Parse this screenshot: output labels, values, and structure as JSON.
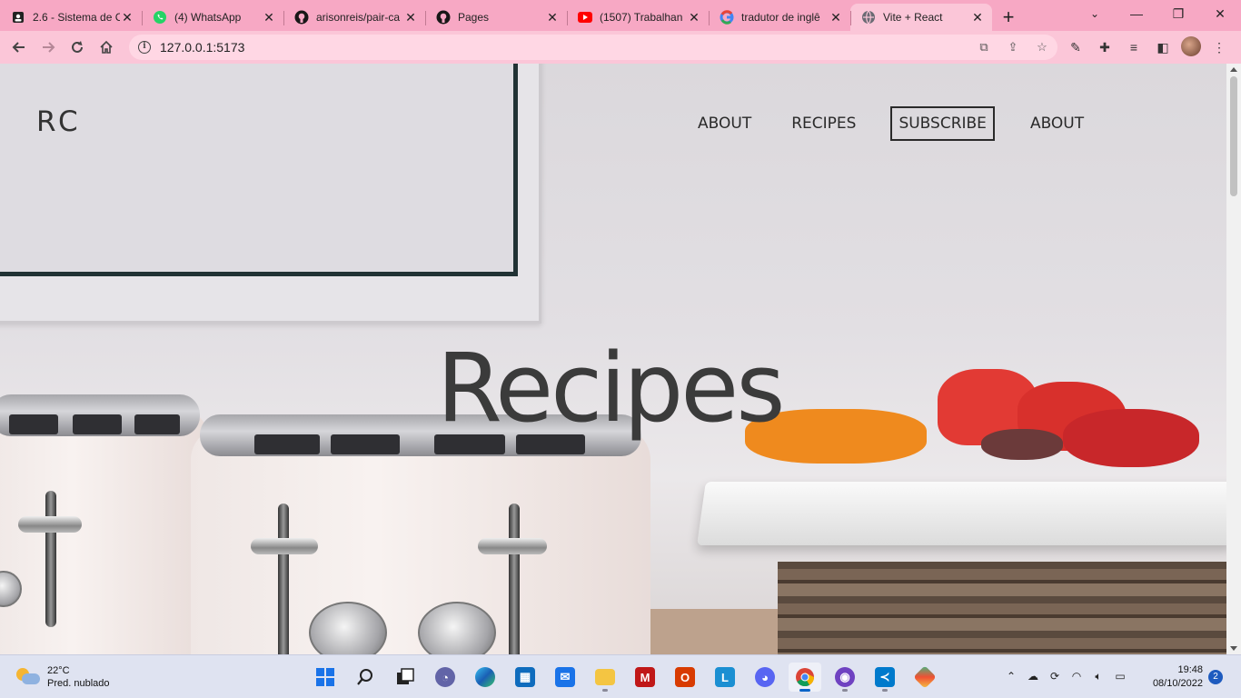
{
  "browser": {
    "tabs": [
      {
        "title": "2.6 - Sistema de C",
        "icon": "classroom-icon",
        "active": false
      },
      {
        "title": "(4) WhatsApp",
        "icon": "whatsapp-icon",
        "active": false
      },
      {
        "title": "arisonreis/pair-ca",
        "icon": "github-icon",
        "active": false
      },
      {
        "title": "Pages",
        "icon": "github-icon",
        "active": false
      },
      {
        "title": "(1507) Trabalhan",
        "icon": "youtube-icon",
        "active": false
      },
      {
        "title": "tradutor de inglê",
        "icon": "google-icon",
        "active": false
      },
      {
        "title": "Vite + React",
        "icon": "globe-icon",
        "active": true
      }
    ],
    "new_tab_symbol": "+",
    "address": "127.0.0.1:5173",
    "colors": {
      "frame": "#f7a8c4",
      "toolbar": "#fbc6d8"
    }
  },
  "site": {
    "logo": "RC",
    "nav": {
      "about_1": "ABOUT",
      "recipes": "RECIPES",
      "subscribe": "SUBSCRIBE",
      "about_2": "ABOUT"
    },
    "hero_title": "Recipes"
  },
  "taskbar": {
    "weather_temp": "22°C",
    "weather_desc": "Pred. nublado",
    "time": "19:48",
    "date": "08/10/2022",
    "notification_count": "2",
    "apps": [
      "windows-start-icon",
      "search-icon",
      "task-view-icon",
      "teams-chat-icon",
      "edge-icon",
      "store-icon",
      "mail-icon",
      "file-explorer-icon",
      "mcafee-icon",
      "office-icon",
      "l-app-icon",
      "discord-icon",
      "chrome-icon",
      "github-desktop-icon",
      "vscode-icon",
      "git-icon"
    ]
  }
}
